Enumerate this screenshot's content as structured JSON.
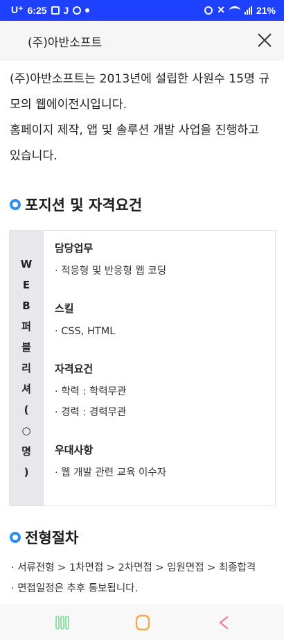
{
  "status_bar": {
    "carrier": "U⁺",
    "time": "6:25",
    "j_label": "J",
    "battery": "21%"
  },
  "header": {
    "title": "(주)아반소프트"
  },
  "intro": {
    "paragraph1": "(주)아반소프트는 2013년에 설립한 사원수 15명 규모의 웹에이전시입니다.",
    "paragraph2": "홈페이지 제작, 앱 및 솔루션 개발 사업을 진행하고 있습니다."
  },
  "position_section": {
    "title": "포지션 및 자격요건",
    "label_chars": [
      "W",
      "E",
      "B",
      "퍼",
      "블",
      "리",
      "셔",
      "(",
      "○",
      "명",
      ")"
    ],
    "blocks": [
      {
        "title": "담당업무",
        "items": [
          "· 적응형 및 반응형 웹 코딩"
        ]
      },
      {
        "title": "스킬",
        "items": [
          "· CSS, HTML"
        ]
      },
      {
        "title": "자격요건",
        "items": [
          "· 학력 : 학력무관",
          "· 경력 : 경력무관"
        ]
      },
      {
        "title": "우대사항",
        "items": [
          "· 웹 개발 관련 교육 이수자"
        ]
      }
    ]
  },
  "process_section": {
    "title": "전형절차",
    "items": [
      "· 서류전형 > 1차면접 > 2차면접 > 임원면접 > 최종합격",
      "· 면접일정은 추후 통보됩니다."
    ]
  },
  "nav": {
    "icons": [
      "recent-apps-icon",
      "home-icon",
      "back-icon"
    ],
    "accent_color": "#8ee0a8",
    "home_color": "#f7a94a",
    "back_color": "#f07ab0"
  },
  "colors": {
    "status_bar": "#1e40ff",
    "section_ring": "#2d8cf0",
    "label_bg": "#e8e8ec"
  }
}
